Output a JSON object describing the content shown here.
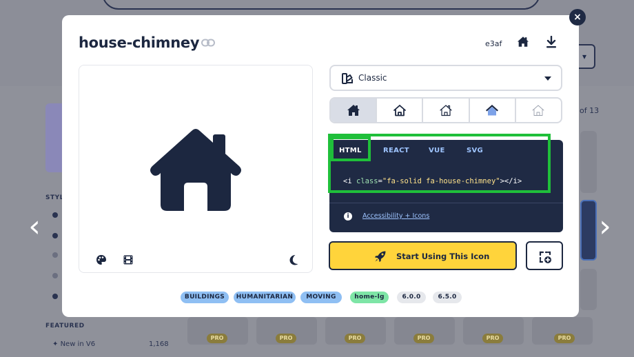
{
  "colors": {
    "brand_navy": "#1c2740",
    "code_bg": "#1f2a44",
    "accent_yellow": "#ffd43b",
    "tag_blue": "#8fbff3",
    "tag_green": "#7ee5a6",
    "highlight_green": "#1fbf3a"
  },
  "background": {
    "results_count": "of 13",
    "sidebar_styles_label": "STYL",
    "featured_label": "FEATURED",
    "new_in_label": "New in V6",
    "new_in_count": "1,168",
    "pro_badge": "PRO",
    "prev_arrow": "‹",
    "next_arrow": "›"
  },
  "modal": {
    "title": "house-chimney",
    "unicode": "e3af",
    "close_label": "×",
    "header_icons": [
      "link-icon",
      "house-icon",
      "download-icon"
    ],
    "preview_icons": [
      "palette-icon",
      "film-icon",
      "moon-icon"
    ],
    "style_select": {
      "label": "Classic",
      "icon": "classic-style-icon"
    },
    "style_options": [
      "solid",
      "regular",
      "light",
      "thin",
      "duotone"
    ],
    "code_tabs": [
      "HTML",
      "REACT",
      "VUE",
      "SVG"
    ],
    "active_code_tab": "HTML",
    "code": {
      "open_tag": "<i ",
      "attr": "class",
      "equals": "=",
      "value": "\"fa-solid fa-house-chimney\"",
      "close_tag": "></i>"
    },
    "accessibility_link": "Accessibility + Icons",
    "start_button": "Start Using This Icon",
    "tags": [
      {
        "label": "BUILDINGS",
        "kind": "blue"
      },
      {
        "label": "HUMANITARIAN",
        "kind": "blue"
      },
      {
        "label": "MOVING",
        "kind": "blue"
      },
      {
        "label": "home-lg",
        "kind": "green"
      },
      {
        "label": "6.0.0",
        "kind": "grey"
      },
      {
        "label": "6.5.0",
        "kind": "grey"
      }
    ]
  }
}
